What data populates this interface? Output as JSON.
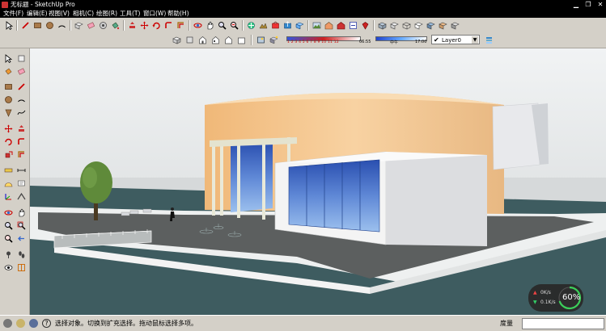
{
  "window": {
    "title": "无标题 - SketchUp Pro"
  },
  "menu": [
    "文件(F)",
    "编辑(E)",
    "视图(V)",
    "相机(C)",
    "绘图(R)",
    "工具(T)",
    "窗口(W)",
    "帮助(H)"
  ],
  "toolbar": {
    "shadow_ticks": "1 2 3 4 5 6 7 8 9 10 11 12",
    "time_left": "06:55",
    "time_mid": "中午",
    "time_right": "17:00",
    "layer": "Layer0"
  },
  "statusbar": {
    "hint": "选择对象。切换到扩充选择。拖动鼠标选择多项。",
    "measure_label": "度量"
  },
  "perf": {
    "speed_up": "0K/s",
    "speed_down": "0.1K/s",
    "percent": "60%"
  },
  "colors": {
    "sky": "#e9ecee",
    "rotunda": "#f2c78f",
    "ground": "#5b5e5e",
    "water": "#3f5f63",
    "glass": "#6e98d6"
  }
}
